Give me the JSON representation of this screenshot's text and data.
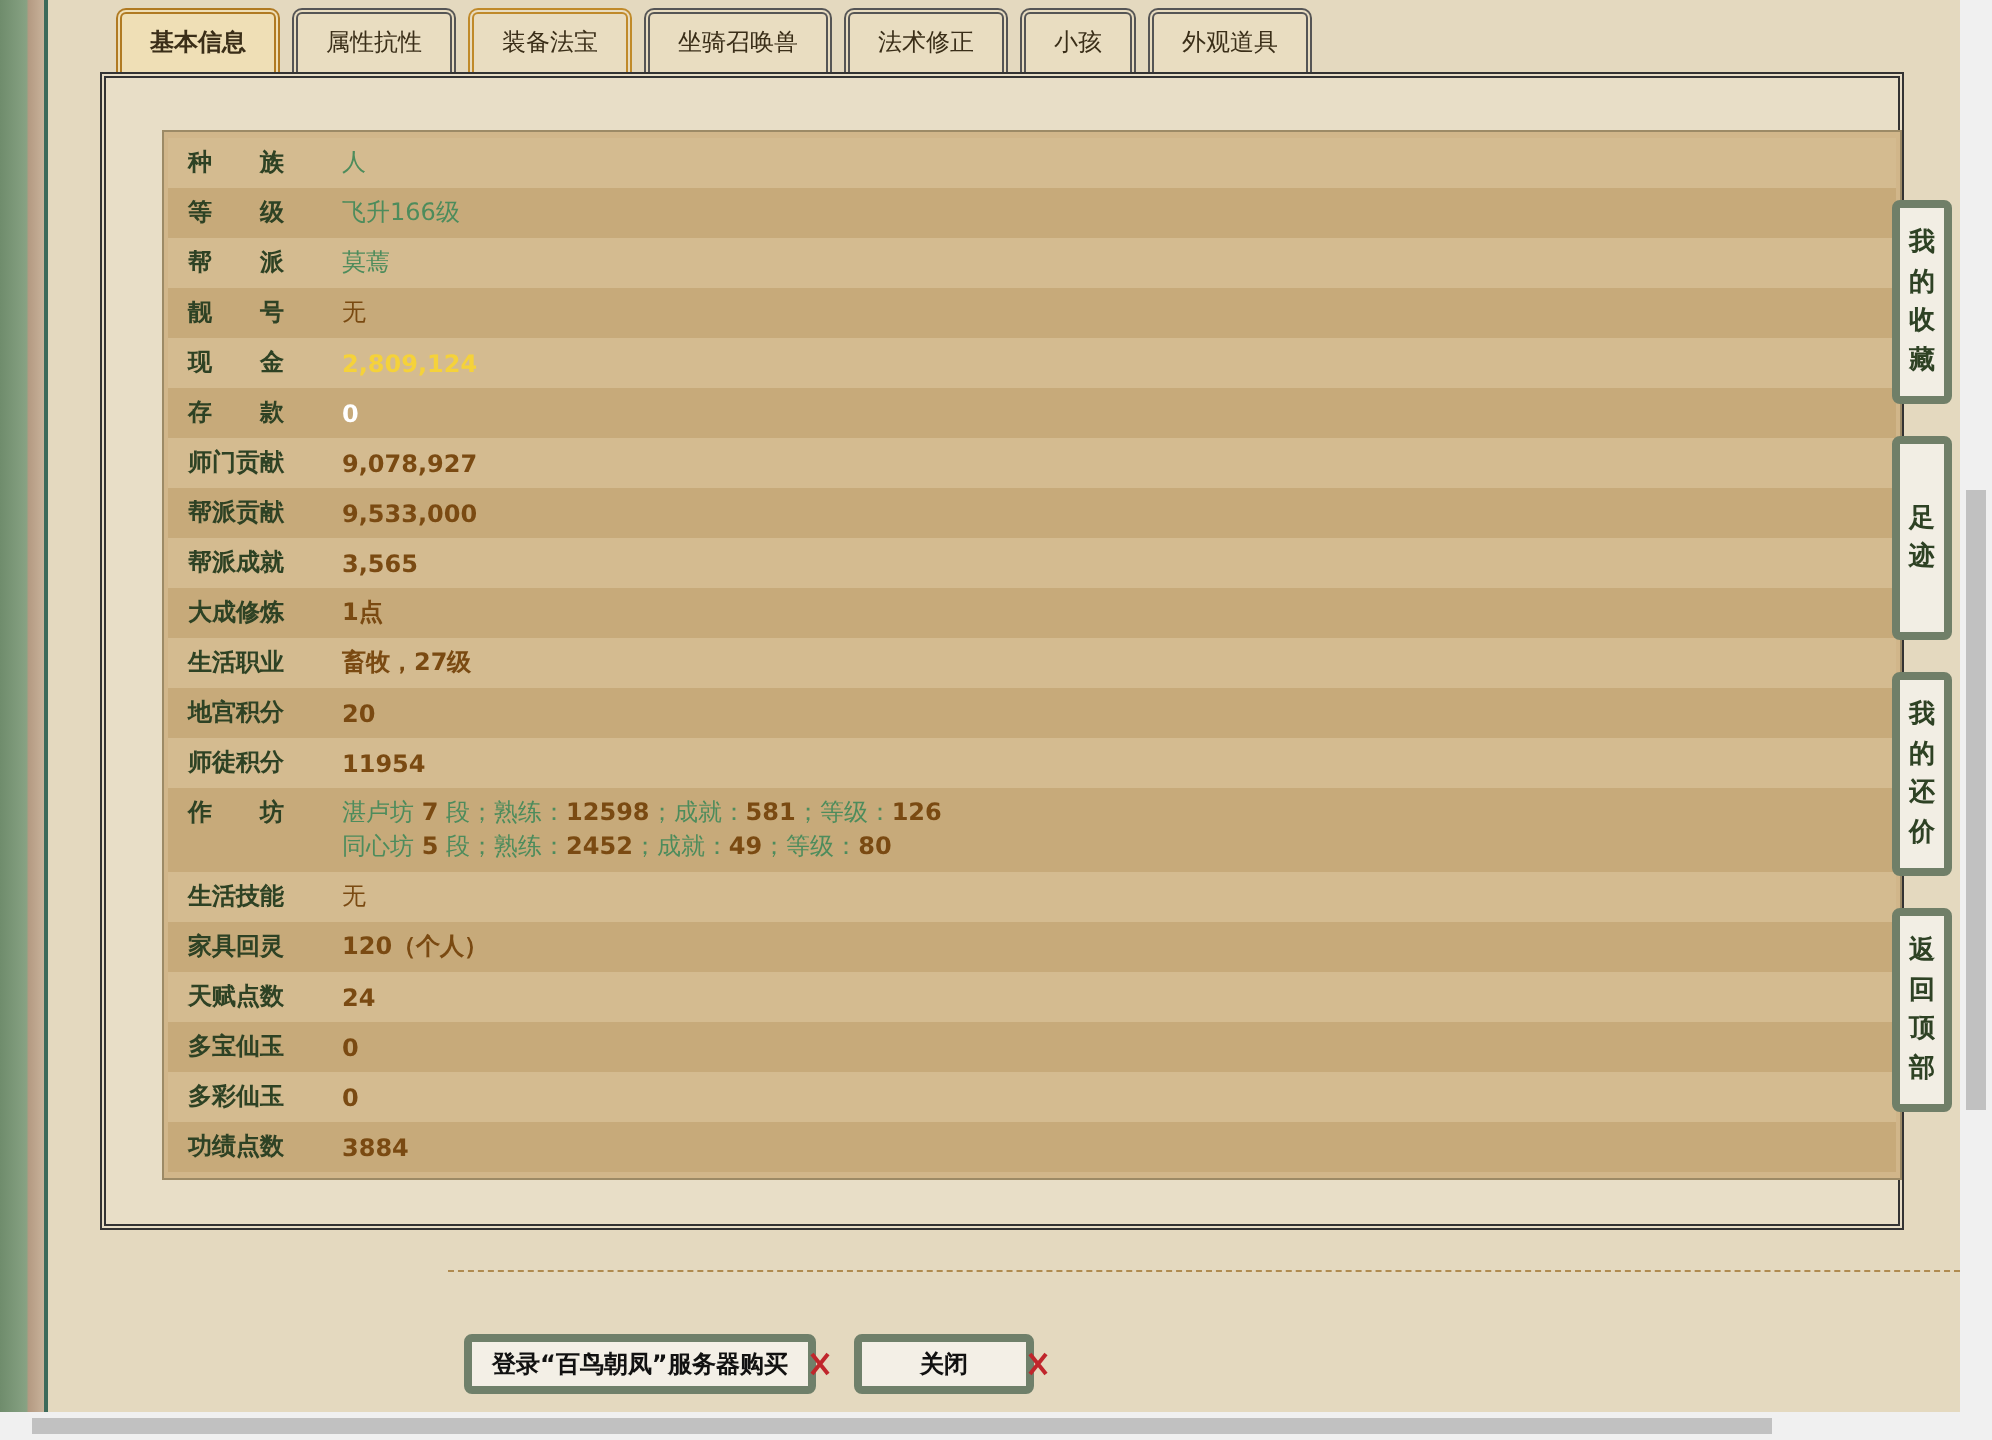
{
  "tabs": [
    {
      "label": "基本信息",
      "selected": true,
      "hover": false
    },
    {
      "label": "属性抗性",
      "selected": false,
      "hover": false
    },
    {
      "label": "装备法宝",
      "selected": false,
      "hover": true
    },
    {
      "label": "坐骑召唤兽",
      "selected": false,
      "hover": false
    },
    {
      "label": "法术修正",
      "selected": false,
      "hover": false
    },
    {
      "label": "小孩",
      "selected": false,
      "hover": false
    },
    {
      "label": "外观道具",
      "selected": false,
      "hover": false
    }
  ],
  "rows": [
    {
      "label": "种 族",
      "kind": "linked",
      "lines": [
        "人"
      ]
    },
    {
      "label": "等 级",
      "kind": "linked",
      "lines": [
        "飞升166级"
      ]
    },
    {
      "label": "帮 派",
      "kind": "linked",
      "lines": [
        "莫蔫"
      ]
    },
    {
      "label": "靓 号",
      "kind": "plain",
      "lines": [
        "无"
      ]
    },
    {
      "label": "现 金",
      "kind": "cash",
      "lines": [
        "2,809,124"
      ]
    },
    {
      "label": "存 款",
      "kind": "deposit",
      "lines": [
        "0"
      ]
    },
    {
      "label": "师门贡献",
      "kind": "stat",
      "lines": [
        "9,078,927"
      ]
    },
    {
      "label": "帮派贡献",
      "kind": "stat",
      "lines": [
        "9,533,000"
      ]
    },
    {
      "label": "帮派成就",
      "kind": "stat",
      "lines": [
        "3,565"
      ]
    },
    {
      "label": "大成修炼",
      "kind": "stat",
      "lines": [
        "1点"
      ]
    },
    {
      "label": "生活职业",
      "kind": "stat",
      "lines": [
        "畜牧，27级"
      ]
    },
    {
      "label": "地宫积分",
      "kind": "stat",
      "lines": [
        "20"
      ]
    },
    {
      "label": "师徒积分",
      "kind": "stat",
      "lines": [
        "11954"
      ]
    },
    {
      "label": "作 坊",
      "kind": "linked",
      "lines": [
        "湛卢坊 **7** 段；熟练：**12598**；成就：**581**；等级：**126**",
        "同心坊 **5** 段；熟练：**2452**；成就：**49**；等级：**80**"
      ]
    },
    {
      "label": "生活技能",
      "kind": "plain",
      "lines": [
        "无"
      ]
    },
    {
      "label": "家具回灵",
      "kind": "stat",
      "lines": [
        "120（个人）"
      ]
    },
    {
      "label": "天赋点数",
      "kind": "stat",
      "lines": [
        "24"
      ]
    },
    {
      "label": "多宝仙玉",
      "kind": "stat",
      "lines": [
        "0"
      ]
    },
    {
      "label": "多彩仙玉",
      "kind": "stat",
      "lines": [
        "0"
      ]
    },
    {
      "label": "功绩点数",
      "kind": "stat",
      "lines": [
        "3884"
      ]
    }
  ],
  "side_nav": [
    "我的收藏",
    "足迹",
    "我的还价",
    "返回顶部"
  ],
  "buttons": [
    "登录“百鸟朝凤”服务器购买",
    "关闭"
  ]
}
